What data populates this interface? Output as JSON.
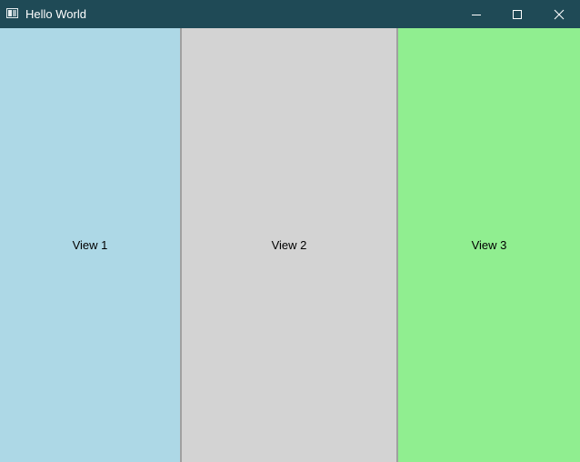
{
  "window": {
    "title": "Hello World",
    "titlebar_color": "#1f4a56"
  },
  "titlebar": {
    "icons": {
      "app": "app-icon",
      "minimize": "minimize-icon",
      "maximize": "maximize-icon",
      "close": "close-icon"
    }
  },
  "views": [
    {
      "label": "View 1",
      "color": "#add8e6"
    },
    {
      "label": "View 2",
      "color": "#d3d3d3"
    },
    {
      "label": "View 3",
      "color": "#90ee90"
    }
  ],
  "splitter_color": "#a0a0a0"
}
